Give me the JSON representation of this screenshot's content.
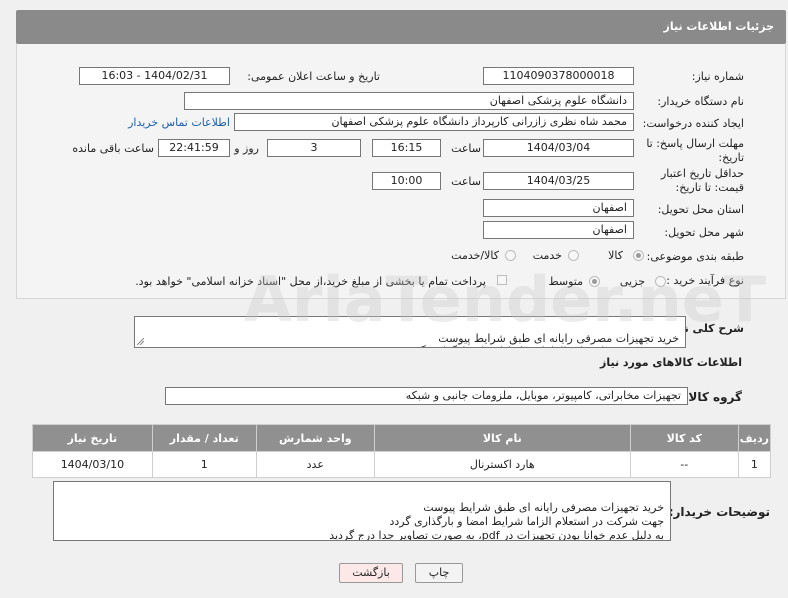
{
  "header": {
    "title": "جزئیات اطلاعات نیاز"
  },
  "need_number": {
    "label": "شماره نیاز:",
    "value": "1104090378000018"
  },
  "announce": {
    "label": "تاریخ و ساعت اعلان عمومی:",
    "value": "1404/02/31 - 16:03"
  },
  "buyer_org": {
    "label": "نام دستگاه خریدار:",
    "value": "دانشگاه علوم پزشکی اصفهان"
  },
  "requester": {
    "label": "ایجاد کننده درخواست:",
    "value": "محمد شاه نظری زازرانی کارپرداز دانشگاه علوم پزشکی اصفهان",
    "contact_link": "اطلاعات تماس خریدار"
  },
  "reply_deadline": {
    "label": "مهلت ارسال پاسخ: تا تاریخ:",
    "date": "1404/03/04",
    "time_label": "ساعت",
    "time": "16:15",
    "days": "3",
    "days_label": "روز و",
    "remaining": "22:41:59",
    "remaining_label": "ساعت باقی مانده"
  },
  "price_validity": {
    "label": "حداقل تاریخ اعتبار قیمت: تا تاریخ:",
    "date": "1404/03/25",
    "time_label": "ساعت",
    "time": "10:00"
  },
  "delivery_province": {
    "label": "استان محل تحویل:",
    "value": "اصفهان"
  },
  "delivery_city": {
    "label": "شهر محل تحویل:",
    "value": "اصفهان"
  },
  "category": {
    "label": "طبقه بندی موضوعی:",
    "options": [
      "کالا",
      "خدمت",
      "کالا/خدمت"
    ],
    "selected": 0
  },
  "process": {
    "label": "نوع فرآیند خرید :",
    "options": [
      "جزیی",
      "متوسط"
    ],
    "selected": 1,
    "note": "پرداخت تمام یا بخشی از مبلغ خرید،از محل \"اسناد خزانه اسلامی\" خواهد بود."
  },
  "summary": {
    "label": "شرح کلی نیاز:",
    "text": "خرید تجهیزات مصرفی رایانه ای طبق شرایط پیوست\nجهت شرکت در استعلام الزاما شرایط امضا و بارگذاری گردد"
  },
  "goods_info": {
    "title": "اطلاعات کالاهای مورد نیاز"
  },
  "goods_group": {
    "label": "گروه کالا:",
    "value": "تجهیزات مخابراتی، کامپیوتر، موبایل، ملزومات جانبی و شبکه"
  },
  "table": {
    "headers": [
      "ردیف",
      "کد کالا",
      "نام کالا",
      "واحد شمارش",
      "تعداد / مقدار",
      "تاریخ نیاز"
    ],
    "rows": [
      [
        "1",
        "--",
        "هارد اکسترنال",
        "عدد",
        "1",
        "1404/03/10"
      ]
    ]
  },
  "buyer_notes": {
    "label": "توضیحات خریدار:",
    "text": "خرید تجهیزات مصرفی رایانه ای طبق شرایط پیوست\nجهت شرکت در استعلام الزاما شرایط امضا و بارگذاری گردد\nبه دلیل عدم خوانا بودن تجهیزات در pdf، به صورت تصاویر جدا درج گردید"
  },
  "buttons": {
    "print": "چاپ",
    "back": "بازگشت"
  },
  "watermark": "AriaTender.neT",
  "colors": {
    "header_bg": "#8a8a8a",
    "link": "#1b5fb0",
    "back_button_bg": "#fde8e8"
  }
}
